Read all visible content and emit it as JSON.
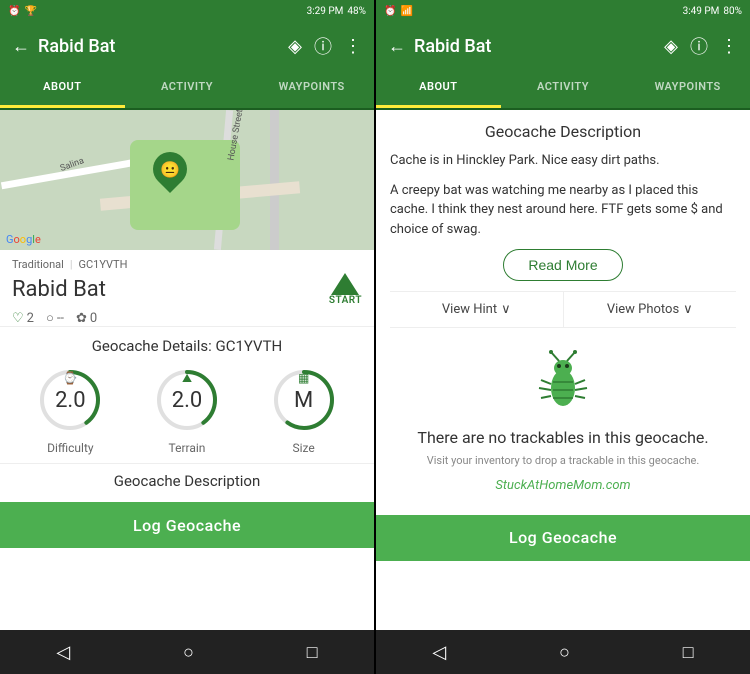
{
  "left_panel": {
    "status_bar": {
      "time": "3:29 PM",
      "battery": "48%"
    },
    "title": "Rabid Bat",
    "tabs": [
      "ABOUT",
      "ACTIVITY",
      "WAYPOINTS"
    ],
    "active_tab": "ABOUT",
    "cache_type": "Traditional",
    "cache_id": "GC1YVTH",
    "cache_name": "Rabid Bat",
    "stats": {
      "hearts": "2",
      "track": "--",
      "awards": "0"
    },
    "start_label": "START",
    "gc_details_title": "Geocache Details: GC1YVTH",
    "circles": [
      {
        "label": "Difficulty",
        "value": "2.0",
        "icon": "⌚",
        "percent": 40
      },
      {
        "label": "Terrain",
        "value": "2.0",
        "icon": "⛰",
        "percent": 40
      },
      {
        "label": "Size",
        "value": "M",
        "icon": "▦",
        "percent": 60
      }
    ],
    "description_title": "Geocache Description",
    "log_btn_label": "Log Geocache"
  },
  "right_panel": {
    "status_bar": {
      "time": "3:49 PM",
      "battery": "80%"
    },
    "title": "Rabid Bat",
    "tabs": [
      "ABOUT",
      "ACTIVITY",
      "WAYPOINTS"
    ],
    "active_tab": "ABOUT",
    "geo_desc_title": "Geocache Description",
    "desc_para1": "Cache is in Hinckley Park. Nice easy dirt paths.",
    "desc_para2": "A creepy bat was watching me nearby as I placed this cache. I think they nest around here. FTF gets some $ and choice of swag.",
    "read_more_label": "Read More",
    "view_hint_label": "View Hint",
    "view_photos_label": "View Photos",
    "trackable_title": "There are no trackables in this geocache.",
    "trackable_sub": "Visit your inventory to drop a trackable in this geocache.",
    "watermark": "StuckAtHomeMom.com",
    "log_btn_label": "Log Geocache"
  },
  "bottom_nav": {
    "back_icon": "◁",
    "home_icon": "○",
    "square_icon": "□"
  },
  "colors": {
    "green": "#2e7d32",
    "light_green": "#4caf50",
    "yellow_tab": "#ffeb3b"
  }
}
